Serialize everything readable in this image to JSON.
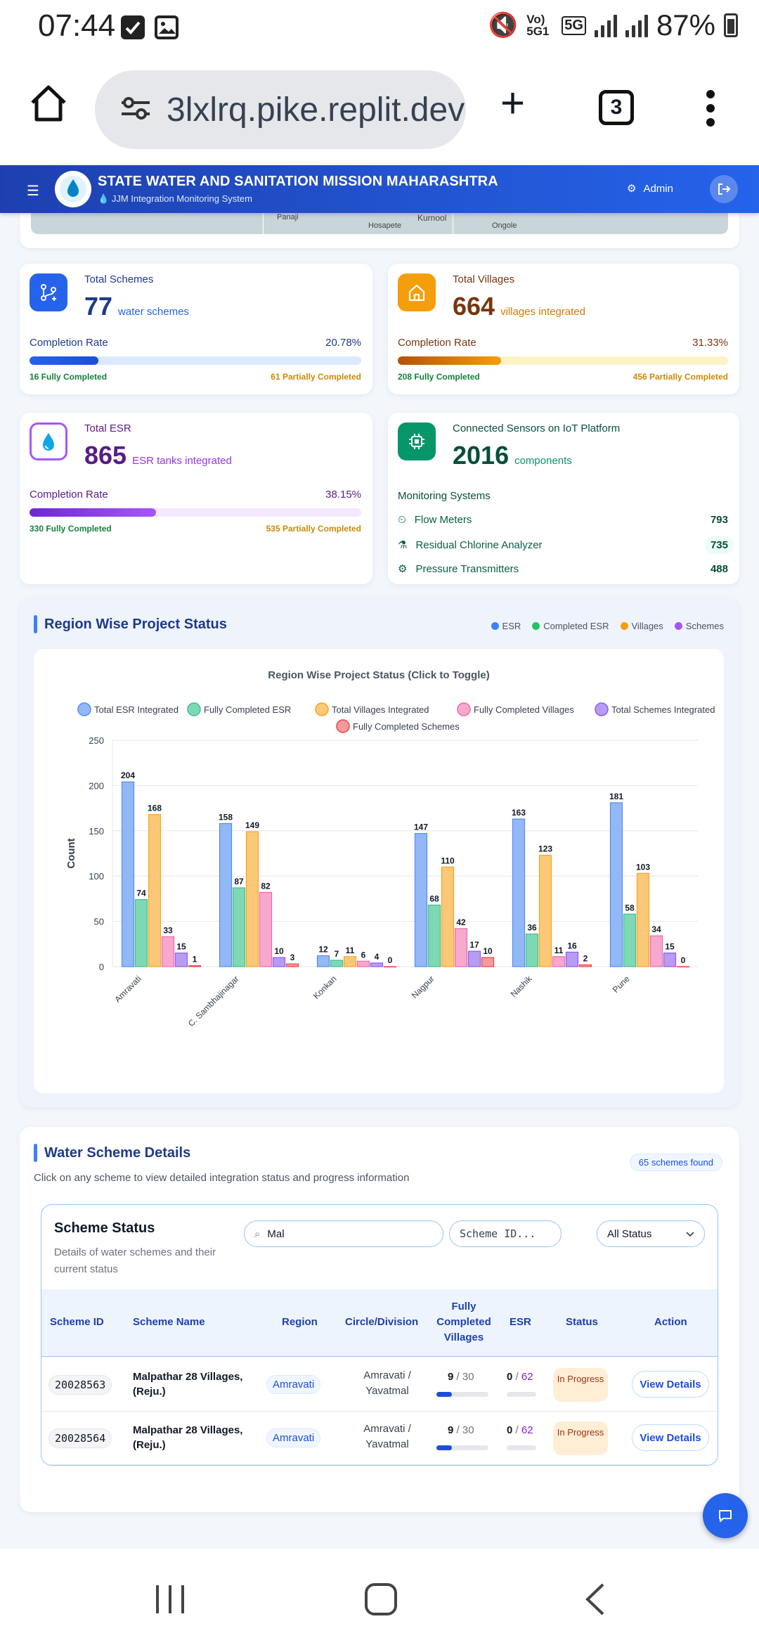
{
  "status_bar": {
    "time": "07:44",
    "network": "Vo) 5G1",
    "net_type": "5G",
    "battery": "87%"
  },
  "browser": {
    "url": "3lxlrq.pike.replit.dev",
    "tab_count": "3"
  },
  "header": {
    "title": "STATE WATER AND SANITATION MISSION MAHARASHTRA",
    "subtitle": "JJM Integration Monitoring System",
    "admin_label": "Admin"
  },
  "map": {
    "labels": [
      "Panaji",
      "Hosapete",
      "Kurnool",
      "Ongole"
    ]
  },
  "cards": {
    "schemes": {
      "label": "Total Schemes",
      "value": "77",
      "unit": "water schemes",
      "rate_label": "Completion Rate",
      "rate": "20.78%",
      "rate_value": 20.78,
      "full": "16 Fully Completed",
      "partial": "61 Partially Completed",
      "color": "#2563eb"
    },
    "villages": {
      "label": "Total Villages",
      "value": "664",
      "unit": "villages integrated",
      "rate_label": "Completion Rate",
      "rate": "31.33%",
      "rate_value": 31.33,
      "full": "208 Fully Completed",
      "partial": "456 Partially Completed",
      "color": "#d97706"
    },
    "esr": {
      "label": "Total ESR",
      "value": "865",
      "unit": "ESR tanks integrated",
      "rate_label": "Completion Rate",
      "rate": "38.15%",
      "rate_value": 38.15,
      "full": "330 Fully Completed",
      "partial": "535 Partially Completed",
      "color": "#7e22ce"
    },
    "sensors": {
      "label": "Connected Sensors on IoT Platform",
      "value": "2016",
      "unit": "components",
      "monitoring_label": "Monitoring Systems",
      "items": [
        {
          "name": "Flow Meters",
          "value": "793",
          "icon": "flow-meter-icon"
        },
        {
          "name": "Residual Chlorine Analyzer",
          "value": "735",
          "icon": "chlorine-analyzer-icon"
        },
        {
          "name": "Pressure Transmitters",
          "value": "488",
          "icon": "pressure-transmitter-icon"
        }
      ]
    }
  },
  "region": {
    "title": "Region Wise Project Status",
    "legend": [
      {
        "label": "ESR",
        "color": "#3b82f6"
      },
      {
        "label": "Completed ESR",
        "color": "#22c55e"
      },
      {
        "label": "Villages",
        "color": "#f59e0b"
      },
      {
        "label": "Schemes",
        "color": "#a855f7"
      }
    ]
  },
  "chart_data": {
    "type": "bar",
    "title": "Region Wise Project Status (Click to Toggle)",
    "xlabel": "",
    "ylabel": "Count",
    "ylim": [
      0,
      250
    ],
    "yticks": [
      0,
      50,
      100,
      150,
      200,
      250
    ],
    "grid": true,
    "legend_position": "top",
    "categories": [
      "Amravati",
      "C. Sambhajinagar",
      "Konkan",
      "Nagpur",
      "Nashik",
      "Pune"
    ],
    "series": [
      {
        "name": "Total ESR Integrated",
        "color": "#93b8f6",
        "stroke": "#4f8df5",
        "values": [
          204,
          158,
          12,
          147,
          163,
          181
        ]
      },
      {
        "name": "Fully Completed ESR",
        "color": "#7fd8b4",
        "stroke": "#3fbf8c",
        "values": [
          74,
          87,
          7,
          68,
          36,
          58
        ]
      },
      {
        "name": "Total Villages Integrated",
        "color": "#fbc877",
        "stroke": "#f5a524",
        "values": [
          168,
          149,
          11,
          110,
          123,
          103
        ]
      },
      {
        "name": "Fully Completed Villages",
        "color": "#f7a8cf",
        "stroke": "#ec6aa8",
        "values": [
          33,
          82,
          6,
          42,
          11,
          34
        ]
      },
      {
        "name": "Total Schemes Integrated",
        "color": "#b79cf2",
        "stroke": "#8b5cf6",
        "values": [
          15,
          10,
          4,
          17,
          16,
          15
        ]
      },
      {
        "name": "Fully Completed Schemes",
        "color": "#f59a9a",
        "stroke": "#ef4444",
        "values": [
          1,
          3,
          0,
          10,
          2,
          0
        ]
      }
    ]
  },
  "details": {
    "title": "Water Scheme Details",
    "description": "Click on any scheme to view detailed integration status and progress information",
    "found": "65 schemes found",
    "status_title": "Scheme Status",
    "status_desc": "Details of water schemes and their current status",
    "search_value": "Mal",
    "scheme_id_placeholder": "Scheme ID...",
    "filter_value": "All Status",
    "columns": [
      "Scheme ID",
      "Scheme Name",
      "Region",
      "Circle/Division",
      "Fully Completed Villages",
      "ESR",
      "Status",
      "Action"
    ],
    "rows": [
      {
        "id": "20028563",
        "name": "Malpathar 28 Villages, (Reju.)",
        "region": "Amravati",
        "circle": "Amravati / Yavatmal",
        "villages_done": "9",
        "villages_total": "30",
        "villages_progress": 0.3,
        "esr_done": "0",
        "esr_total": "62",
        "esr_progress": 0.0,
        "status": "In Progress",
        "action": "View Details"
      },
      {
        "id": "20028564",
        "name": "Malpathar 28 Villages, (Reju.)",
        "region": "Amravati",
        "circle": "Amravati / Yavatmal",
        "villages_done": "9",
        "villages_total": "30",
        "villages_progress": 0.3,
        "esr_done": "0",
        "esr_total": "62",
        "esr_progress": 0.0,
        "status": "In Progress",
        "action": "View Details"
      }
    ]
  }
}
